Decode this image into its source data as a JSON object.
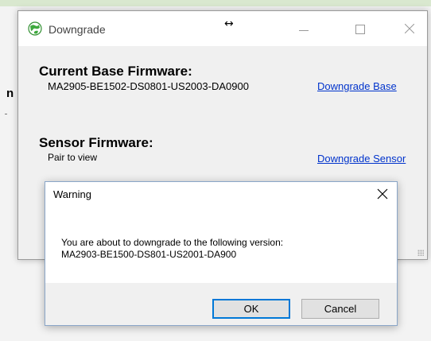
{
  "background": {
    "partial_letter": "n"
  },
  "window": {
    "title": "Downgrade",
    "resize_glyph": "↔",
    "icon": "globe-icon",
    "base_section": {
      "heading": "Current Base Firmware:",
      "version": "MA2905-BE1502-DS0801-US2003-DA0900",
      "action": "Downgrade Base"
    },
    "sensor_section": {
      "heading": "Sensor Firmware:",
      "status": "Pair to view",
      "action": "Downgrade Sensor"
    }
  },
  "dialog": {
    "title": "Warning",
    "message_line1": "You are about to downgrade to the following version:",
    "message_line2": "MA2903-BE1500-DS801-US2001-DA900",
    "ok_label": "OK",
    "cancel_label": "Cancel"
  },
  "colors": {
    "link": "#0033cc",
    "focus_border": "#0078d7",
    "icon_green": "#3ea93e"
  }
}
